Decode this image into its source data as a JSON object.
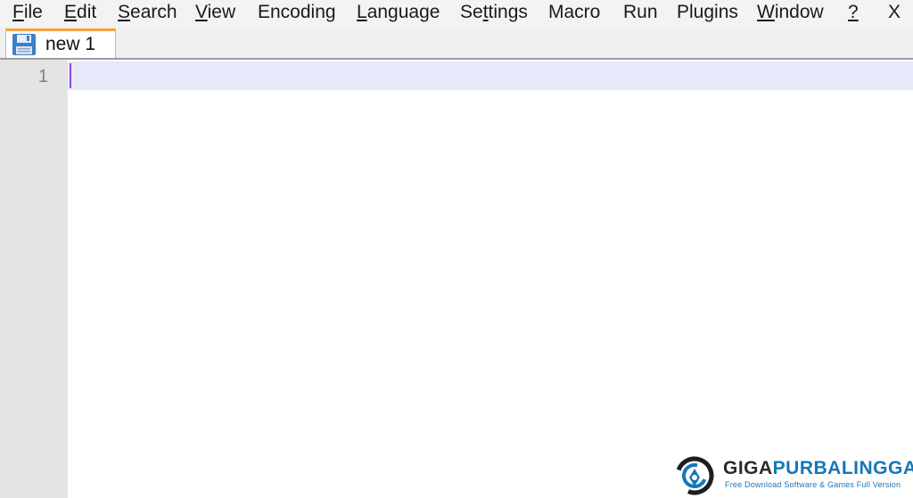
{
  "menu": {
    "items": [
      {
        "label": "File",
        "accel_index": 0
      },
      {
        "label": "Edit",
        "accel_index": 0
      },
      {
        "label": "Search",
        "accel_index": 0
      },
      {
        "label": "View",
        "accel_index": 0
      },
      {
        "label": "Encoding",
        "accel_index": -1
      },
      {
        "label": "Language",
        "accel_index": 0
      },
      {
        "label": "Settings",
        "accel_index": 2
      },
      {
        "label": "Macro",
        "accel_index": -1
      },
      {
        "label": "Run",
        "accel_index": -1
      },
      {
        "label": "Plugins",
        "accel_index": -1
      },
      {
        "label": "Window",
        "accel_index": 0
      },
      {
        "label": "?",
        "accel_index": 0
      }
    ],
    "close_label": "X"
  },
  "tabs": [
    {
      "label": "new 1",
      "icon": "save-disk-icon",
      "active": true,
      "accent_color": "#f2a43c"
    }
  ],
  "editor": {
    "line_numbers": [
      "1"
    ],
    "current_line_color": "#e8e8fb",
    "caret_color": "#8a4bd8"
  },
  "watermark": {
    "title_part1": "GIGA",
    "title_part2": "PURBALINGGA",
    "tagline": "Free Download Software & Games Full Version",
    "brand_color": "#1577b8"
  }
}
